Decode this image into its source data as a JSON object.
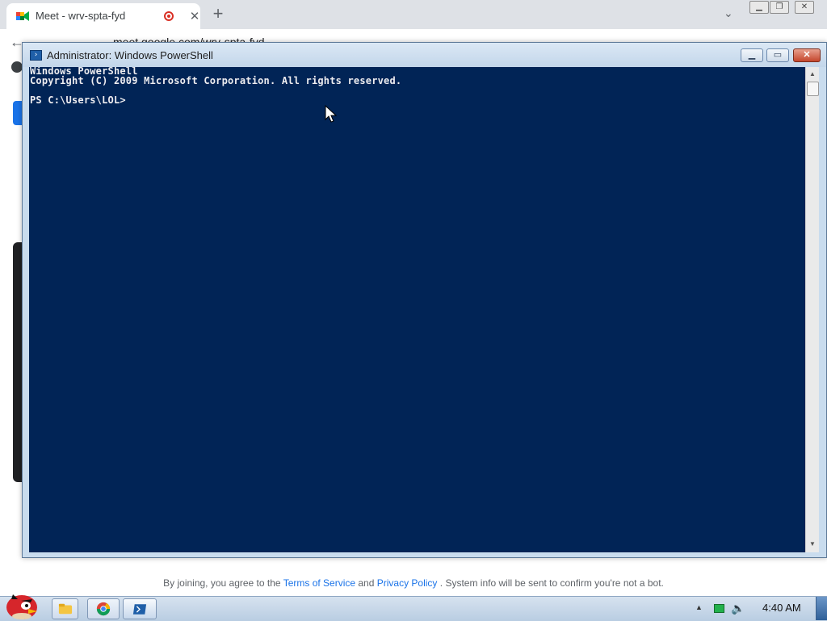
{
  "browser": {
    "tab_title": "Meet - wrv-spta-fyd",
    "tab_close": "✕",
    "new_tab": "+",
    "tab_dropdown": "⌄",
    "url": "meet.google.com/wrv-spta-fyd",
    "back": "←",
    "footer": {
      "prefix": "By joining, you agree to the ",
      "terms": "Terms of Service",
      "and": " and ",
      "privacy": "Privacy Policy",
      "suffix": " . System info will be sent to confirm you're not a bot."
    }
  },
  "powershell": {
    "title": "Administrator: Windows PowerShell",
    "icon_glyph": "›",
    "min_label": "▁",
    "max_label": "▭",
    "close_label": "✕",
    "lines": [
      "Windows PowerShell",
      "Copyright (C) 2009 Microsoft Corporation. All rights reserved.",
      "PS C:\\Users\\LOL>"
    ],
    "colors": {
      "console_bg": "#012456",
      "console_text": "#eeedf0"
    }
  },
  "taskbar": {
    "clock": "4:40 AM",
    "tray_arrow": "▲",
    "volume": "🔈"
  }
}
